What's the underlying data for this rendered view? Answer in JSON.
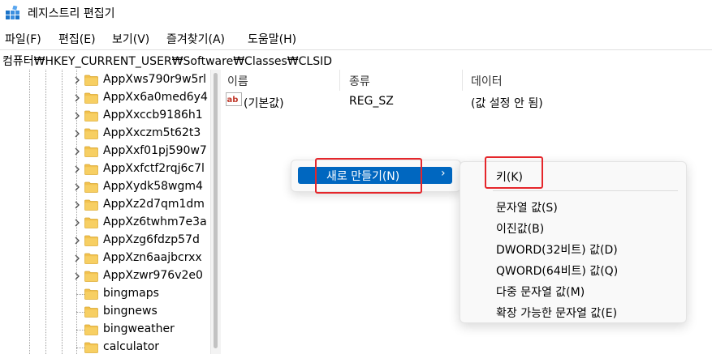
{
  "window": {
    "title": "레지스트리 편집기",
    "app_icon": "regedit-icon"
  },
  "menubar": {
    "items": [
      "파일(F)",
      "편집(E)",
      "보기(V)",
      "즐겨찾기(A)",
      "도움말(H)"
    ]
  },
  "address": "컴퓨터₩HKEY_CURRENT_USER₩Software₩Classes₩CLSID",
  "tree": {
    "items": [
      {
        "label": "AppXws790r9w5rl",
        "expandable": true
      },
      {
        "label": "AppXx6a0med6y4",
        "expandable": true
      },
      {
        "label": "AppXxccb9186h1",
        "expandable": true
      },
      {
        "label": "AppXxczm5t62t3",
        "expandable": true
      },
      {
        "label": "AppXxf01pj590w7",
        "expandable": true
      },
      {
        "label": "AppXxfctf2rqj6c7l",
        "expandable": true
      },
      {
        "label": "AppXydk58wgm4",
        "expandable": true
      },
      {
        "label": "AppXz2d7qm1dm",
        "expandable": true
      },
      {
        "label": "AppXz6twhm7e3a",
        "expandable": true
      },
      {
        "label": "AppXzg6fdzp57d",
        "expandable": true
      },
      {
        "label": "AppXzn6aajbcrxx",
        "expandable": true
      },
      {
        "label": "AppXzwr976v2e0",
        "expandable": true
      },
      {
        "label": "bingmaps",
        "expandable": false
      },
      {
        "label": "bingnews",
        "expandable": false
      },
      {
        "label": "bingweather",
        "expandable": false
      },
      {
        "label": "calculator",
        "expandable": false
      }
    ]
  },
  "values": {
    "columns": {
      "name": "이름",
      "type": "종류",
      "data": "데이터"
    },
    "rows": [
      {
        "name": "(기본값)",
        "type": "REG_SZ",
        "data": "(값 설정 안 됨)",
        "icon": "string-value-icon"
      }
    ]
  },
  "context_menu": {
    "new_label": "새로 만들기(N)",
    "arrow": "›"
  },
  "submenu": {
    "key": "키(K)",
    "items": [
      "문자열 값(S)",
      "이진값(B)",
      "DWORD(32비트) 값(D)",
      "QWORD(64비트) 값(Q)",
      "다중 문자열 값(M)",
      "확장 가능한 문자열 값(E)"
    ]
  },
  "colors": {
    "highlight": "#0067c0",
    "annotation": "#e5262b",
    "folder": "#f2c14e"
  }
}
